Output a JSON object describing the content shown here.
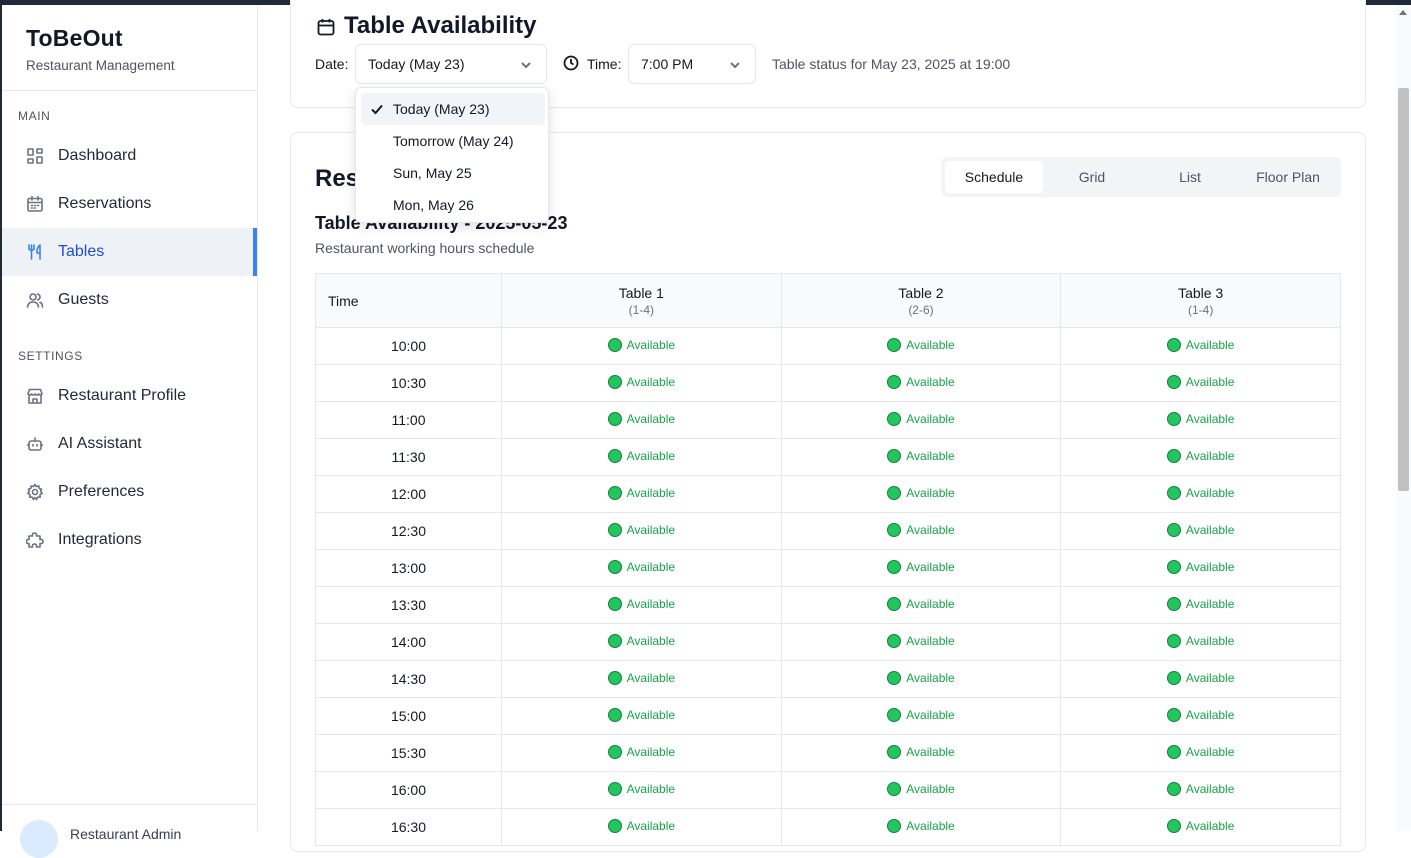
{
  "brand": {
    "title": "ToBeOut",
    "subtitle": "Restaurant Management"
  },
  "sidebar": {
    "main_label": "MAIN",
    "settings_label": "SETTINGS",
    "main_items": [
      {
        "label": "Dashboard",
        "icon": "dashboard-icon"
      },
      {
        "label": "Reservations",
        "icon": "calendar-icon"
      },
      {
        "label": "Tables",
        "icon": "utensils-icon",
        "active": true
      },
      {
        "label": "Guests",
        "icon": "users-icon"
      }
    ],
    "settings_items": [
      {
        "label": "Restaurant Profile",
        "icon": "store-icon"
      },
      {
        "label": "AI Assistant",
        "icon": "bot-icon"
      },
      {
        "label": "Preferences",
        "icon": "gear-icon"
      },
      {
        "label": "Integrations",
        "icon": "puzzle-icon"
      }
    ],
    "user_name": "Restaurant Admin"
  },
  "availability": {
    "title": "Table Availability",
    "date_label": "Date:",
    "date_value": "Today (May 23)",
    "time_label": "Time:",
    "time_value": "7:00 PM",
    "status": "Table status for May 23, 2025 at 19:00"
  },
  "date_options": [
    {
      "label": "Today (May 23)",
      "selected": true
    },
    {
      "label": "Tomorrow (May 24)"
    },
    {
      "label": "Sun, May 25"
    },
    {
      "label": "Mon, May 26"
    }
  ],
  "layout_section": {
    "title": "Rest",
    "tabs": [
      "Schedule",
      "Grid",
      "List",
      "Floor Plan"
    ],
    "active_tab": "Schedule",
    "schedule_title": "Table Availability - 2025-05-23",
    "schedule_subtitle": "Restaurant working hours schedule"
  },
  "schedule": {
    "time_header": "Time",
    "tables": [
      {
        "name": "Table 1",
        "capacity": "(1-4)"
      },
      {
        "name": "Table 2",
        "capacity": "(2-6)"
      },
      {
        "name": "Table 3",
        "capacity": "(1-4)"
      }
    ],
    "status_label": "Available",
    "slots": [
      "10:00",
      "10:30",
      "11:00",
      "11:30",
      "12:00",
      "12:30",
      "13:00",
      "13:30",
      "14:00",
      "14:30",
      "15:00",
      "15:30",
      "16:00",
      "16:30"
    ]
  },
  "colors": {
    "accent": "#3b82f6",
    "available": "#16a34a",
    "available_dot": "#22c55e"
  }
}
